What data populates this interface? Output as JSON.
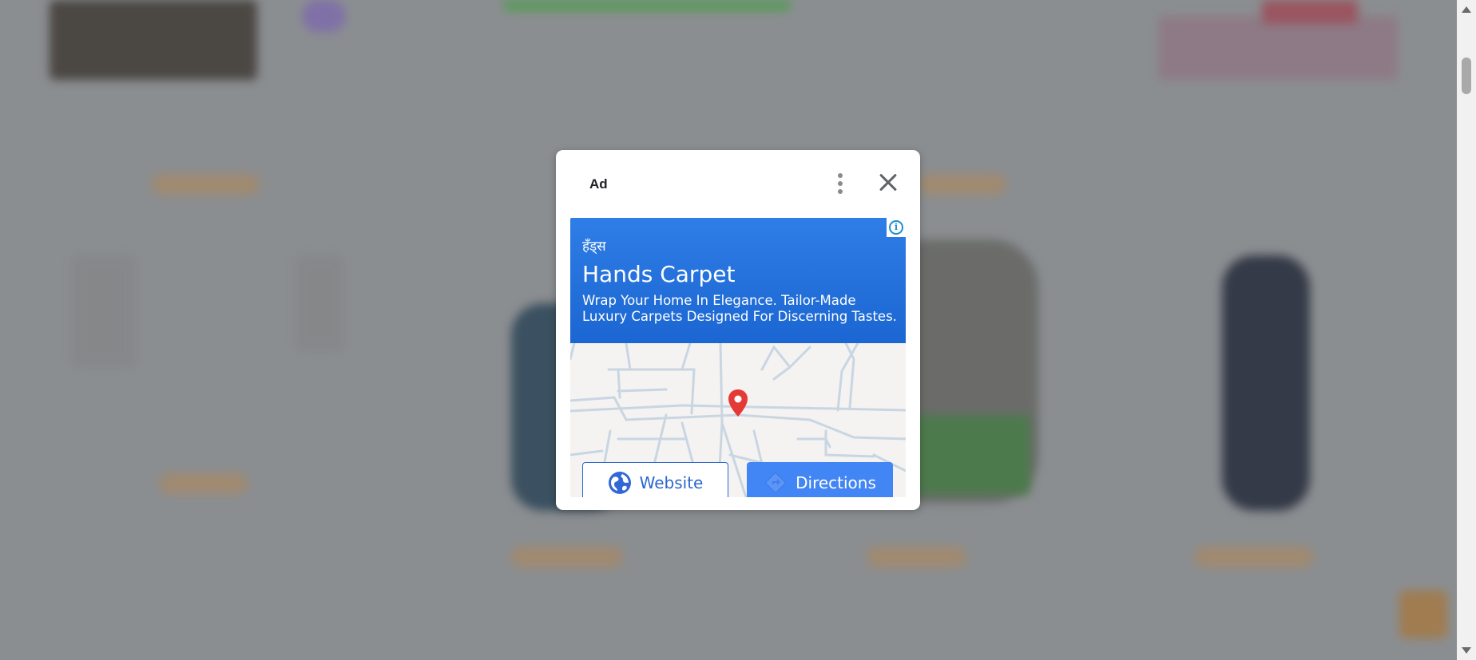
{
  "ad": {
    "label": "Ad",
    "brand_local": "हँड्स",
    "headline": "Hands Carpet",
    "description": "Wrap Your Home In Elegance. Tailor-Made Luxury Carpets Designed For Discerning Tastes.",
    "website_label": "Website",
    "directions_label": "Directions",
    "adchoices_glyph": "i",
    "icons": [
      "more-vert-icon",
      "close-icon",
      "adchoices-icon",
      "map-pin-icon",
      "globe-icon",
      "directions-icon"
    ]
  },
  "colors": {
    "overlay": "#8a8d90",
    "ad_blue": "#2f7de6",
    "directions_blue": "#4285f4",
    "pin_red": "#e53935"
  }
}
